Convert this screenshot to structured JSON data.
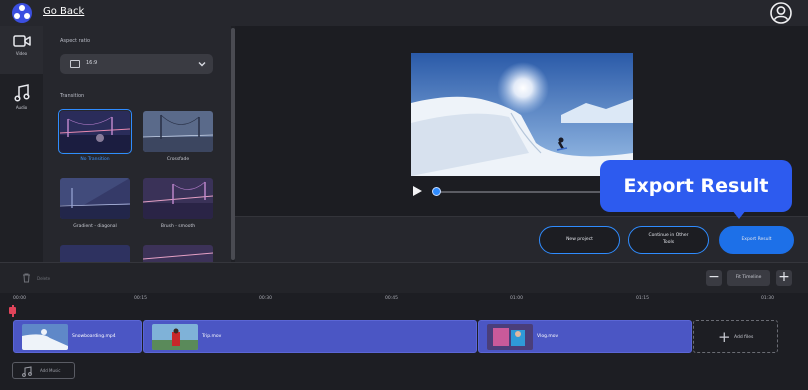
{
  "header": {
    "back_label": "Go Back",
    "logo_icon": "app-logo-icon",
    "user_icon": "user-circle-icon"
  },
  "rail": {
    "items": [
      {
        "label": "Video",
        "icon": "video-camera-icon",
        "active": true
      },
      {
        "label": "Audio",
        "icon": "music-note-icon",
        "active": false
      }
    ]
  },
  "panel": {
    "aspect_title": "Aspect ratio",
    "aspect_value": "16:9",
    "transition_title": "Transition",
    "transitions": [
      {
        "label": "No Transition",
        "selected": true
      },
      {
        "label": "Crossfade",
        "selected": false
      },
      {
        "label": "Gradient - diagonal",
        "selected": false
      },
      {
        "label": "Brush - smooth",
        "selected": false
      }
    ]
  },
  "preview": {
    "play_icon": "play-icon",
    "progress": 0.0
  },
  "callout": {
    "text": "Export Result"
  },
  "actions": {
    "new_project": "New project",
    "continue_line1": "Continue in Other",
    "continue_line2": "Tools",
    "export": "Export Result"
  },
  "timeline": {
    "delete_label": "Delete",
    "fit_label": "Fit Timeline",
    "zoom_out": "−",
    "zoom_in": "+",
    "ticks": [
      "00:00",
      "00:15",
      "00:30",
      "00:45",
      "01:00",
      "01:15",
      "01:30"
    ],
    "clips": [
      {
        "name": "Snowboarding.mp4"
      },
      {
        "name": "Trip.mov"
      },
      {
        "name": "Vlog.mov"
      }
    ],
    "add_files": "Add files",
    "add_music": "Add Music"
  },
  "colors": {
    "accent": "#2f8cff",
    "callout": "#2d5bef",
    "clip": "#4b56c4",
    "playhead": "#e0445a"
  }
}
